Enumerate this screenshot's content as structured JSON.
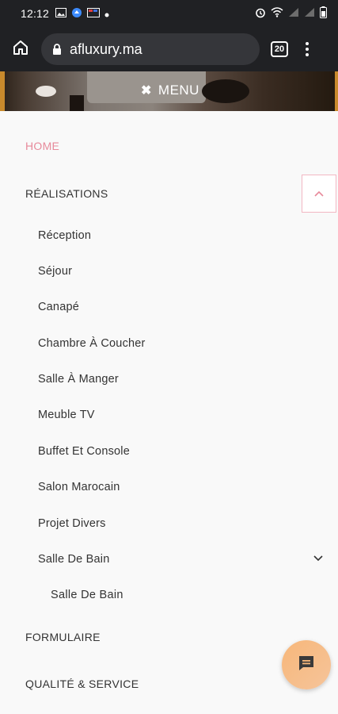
{
  "status_bar": {
    "time": "12:12"
  },
  "browser": {
    "url": "afluxury.ma",
    "tab_count": "20"
  },
  "header": {
    "menu_label": "MENU",
    "close_symbol": "✖"
  },
  "nav": {
    "home": "HOME",
    "realisations": "RÉALISATIONS",
    "sub_items": [
      "Réception",
      "Séjour",
      "Canapé",
      "Chambre À Coucher",
      "Salle À Manger",
      "Meuble TV",
      "Buffet Et Console",
      "Salon Marocain",
      "Projet Divers",
      "Salle De Bain"
    ],
    "subsub_item": "Salle De Bain",
    "formulaire": "FORMULAIRE",
    "qualite": "QUALITÉ & SERVICE"
  },
  "colors": {
    "accent": "#e78a9b",
    "chat": "#f7b77a",
    "chrome": "#202124"
  }
}
